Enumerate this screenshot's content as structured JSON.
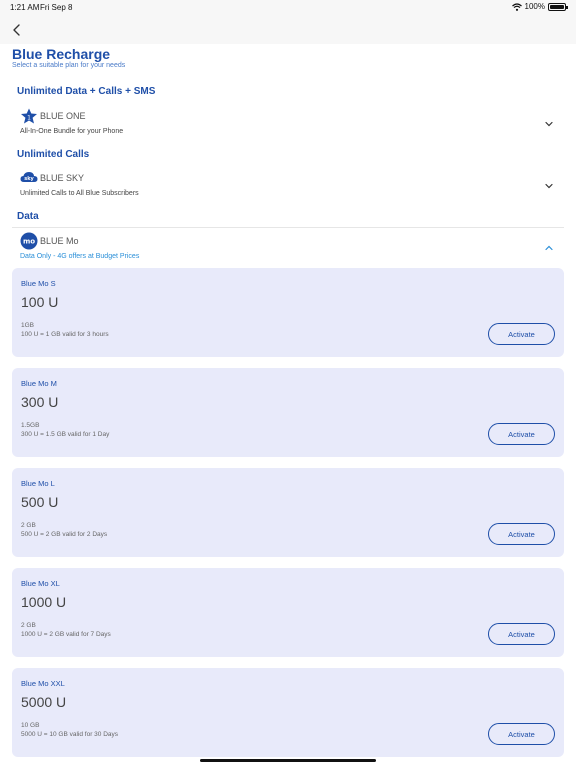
{
  "status_bar": {
    "time": "1:21 AM",
    "date": "Fri Sep 8",
    "battery": "100%"
  },
  "header": {
    "title": "Blue Recharge",
    "subtitle": "Select a suitable plan for your needs"
  },
  "sections": [
    {
      "heading": "Unlimited Data + Calls + SMS",
      "plan": {
        "name": "BLUE ONE",
        "description": "All-In-One Bundle for your Phone",
        "icon": "star-badge-icon"
      }
    },
    {
      "heading": "Unlimited Calls",
      "plan": {
        "name": "BLUE SKY",
        "description": "Unlimited Calls to All Blue Subscribers",
        "icon": "sky-cloud-icon"
      }
    },
    {
      "heading": "Data",
      "plan": {
        "name": "BLUE Mo",
        "description": "Data Only - 4G offers at Budget Prices",
        "icon": "mo-circle-icon"
      }
    }
  ],
  "cards": [
    {
      "name": "Blue Mo S",
      "price": "100 U",
      "data": "1GB",
      "detail": "100 U = 1 GB valid for 3 hours",
      "button": "Activate"
    },
    {
      "name": "Blue Mo M",
      "price": "300 U",
      "data": "1.5GB",
      "detail": "300 U = 1.5 GB valid for 1 Day",
      "button": "Activate"
    },
    {
      "name": "Blue Mo L",
      "price": "500 U",
      "data": "2 GB",
      "detail": "500 U = 2 GB valid for 2 Days",
      "button": "Activate"
    },
    {
      "name": "Blue Mo XL",
      "price": "1000 U",
      "data": "2 GB",
      "detail": "1000 U = 2 GB valid for 7 Days",
      "button": "Activate"
    },
    {
      "name": "Blue Mo XXL",
      "price": "5000 U",
      "data": "10 GB",
      "detail": "5000 U = 10 GB valid for 30 Days",
      "button": "Activate"
    }
  ],
  "colors": {
    "brand": "#1f4fa8",
    "accent": "#2a8fd8",
    "card_bg": "#e8eafa"
  },
  "icons": {
    "back": "chevron-left-icon",
    "collapsed": "chevron-down-icon",
    "expanded": "chevron-up-icon"
  }
}
